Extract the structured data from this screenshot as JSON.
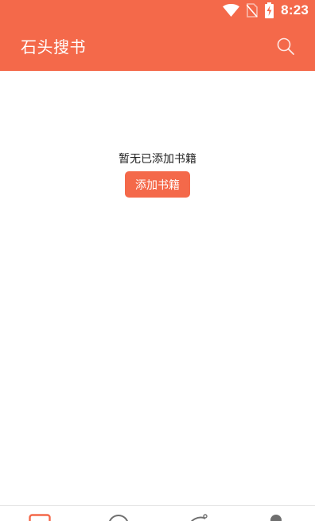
{
  "status_bar": {
    "time": "8:23",
    "icons": [
      "wifi-icon",
      "no-sim-icon",
      "battery-charging-icon"
    ]
  },
  "app_bar": {
    "title": "石头搜书",
    "search_icon": "search-icon"
  },
  "empty_state": {
    "message": "暂无已添加书籍",
    "button_label": "添加书籍"
  },
  "bottom_nav": {
    "items": [
      {
        "icon": "bookshelf-icon",
        "active": true
      },
      {
        "icon": "discover-icon",
        "active": false
      },
      {
        "icon": "category-icon",
        "active": false
      },
      {
        "icon": "profile-icon",
        "active": false
      }
    ]
  },
  "colors": {
    "accent": "#f4694a",
    "background": "#ffffff",
    "text": "#222222",
    "inactive_icon": "#6f6f6f"
  }
}
